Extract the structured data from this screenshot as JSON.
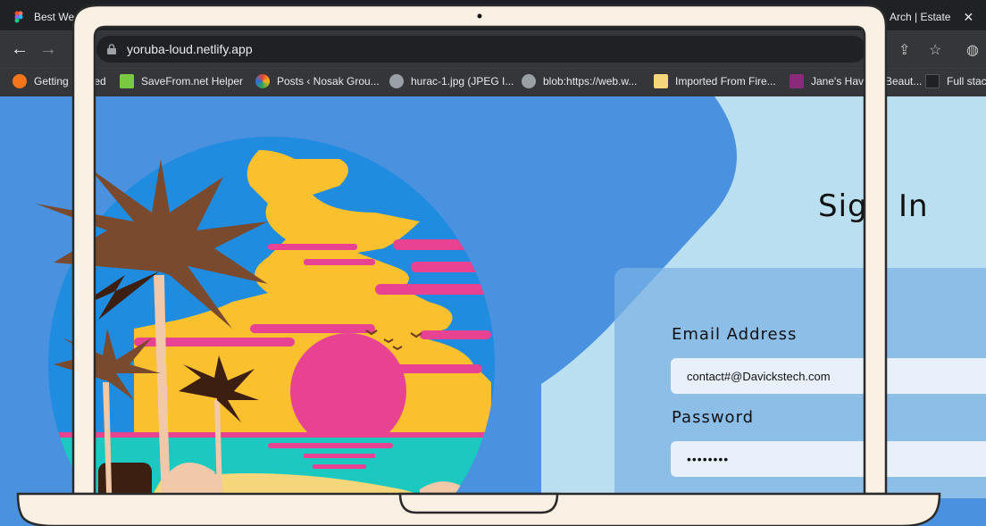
{
  "browser": {
    "tabs": [
      {
        "title": "Best We",
        "icon": "figma-icon"
      },
      {
        "title": "Arch | Estate",
        "icon": "globe-icon"
      }
    ],
    "tab_close": "✕",
    "url": "yoruba-loud.netlify.app",
    "bookmarks": [
      {
        "label": "Getting Started",
        "icon": "firefox-icon",
        "color": "#f5761a"
      },
      {
        "label": "SaveFrom.net Helper",
        "icon": "download-arrow-icon",
        "color": "#7ac943"
      },
      {
        "label": "Posts ‹ Nosak Grou...",
        "icon": "wordpress-icon",
        "color": "#e8452c"
      },
      {
        "label": "hurac-1.jpg (JPEG I...",
        "icon": "globe-icon",
        "color": "#9aa0a6"
      },
      {
        "label": "blob:https://web.w...",
        "icon": "globe-icon",
        "color": "#9aa0a6"
      },
      {
        "label": "Imported From Fire...",
        "icon": "folder-icon",
        "color": "#f6d67a"
      },
      {
        "label": "Jane's Haven - Beaut...",
        "icon": "site-icon",
        "color": "#8b2a7a"
      },
      {
        "label": "Full stack",
        "icon": "page-icon",
        "color": "#3c3d41"
      }
    ]
  },
  "signin": {
    "title": "Sign In",
    "email_label": "Email Address",
    "email_value": "contact#@Davickstech.com",
    "password_label": "Password",
    "password_value": "••••••••"
  },
  "colors": {
    "page_bg": "#4a91df",
    "light_panel": "#b9dff0",
    "sky": "#1f8ce0",
    "sun": "#e84393",
    "clouds": "#fbc02d",
    "sea": "#1cc9c0",
    "frame": "#fbf0e4"
  }
}
